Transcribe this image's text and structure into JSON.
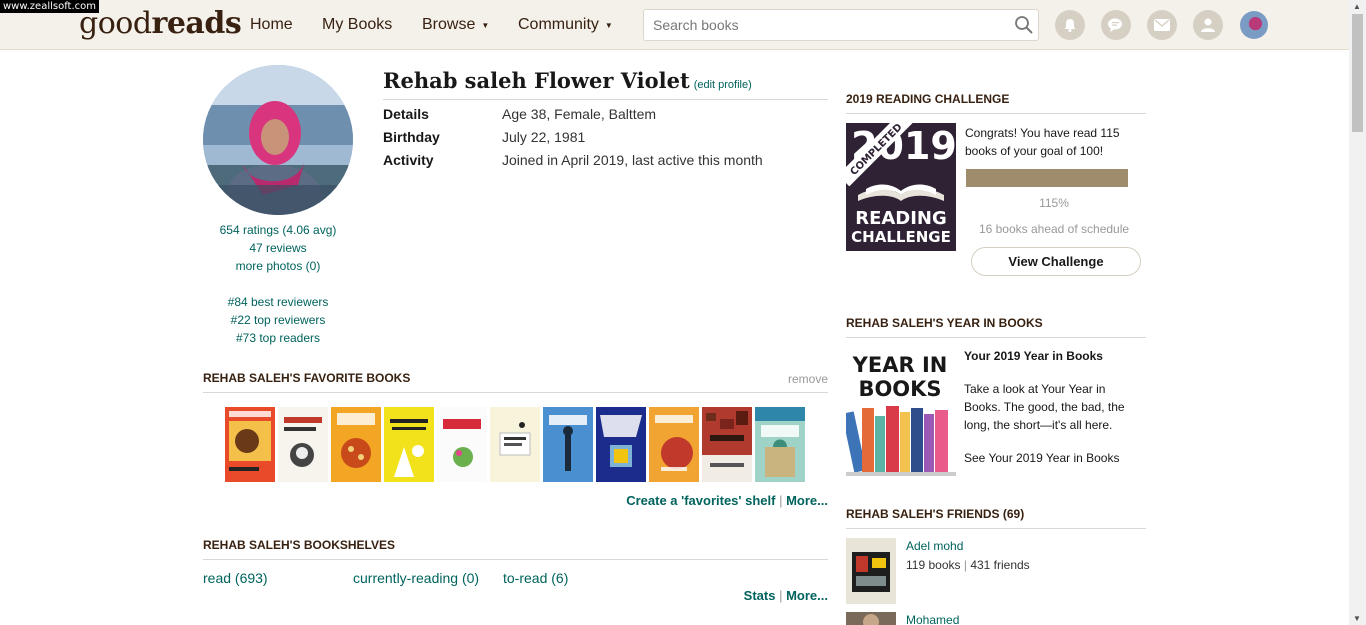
{
  "watermark": "www.zeallsoft.com",
  "header": {
    "logo_left": "good",
    "logo_right": "reads",
    "nav": {
      "home": "Home",
      "my_books": "My Books",
      "browse": "Browse",
      "community": "Community"
    },
    "search_placeholder": "Search books",
    "icons": [
      "notifications-icon",
      "discussions-icon",
      "messages-icon",
      "friends-icon",
      "user-avatar"
    ]
  },
  "profile": {
    "name": "Rehab saleh Flower Violet",
    "edit_profile": "(edit profile)",
    "details": [
      {
        "label": "Details",
        "value": "Age 38, Female, Balttem"
      },
      {
        "label": "Birthday",
        "value": "July 22, 1981"
      },
      {
        "label": "Activity",
        "value": "Joined in April 2019, last active this month"
      }
    ],
    "stats": {
      "ratings": "654 ratings (4.06 avg)",
      "reviews": "47 reviews",
      "photos": "more photos (0)"
    },
    "ranks": {
      "best_reviewers": "#84 best reviewers",
      "top_reviewers": "#22 top reviewers",
      "top_readers": "#73 top readers"
    }
  },
  "favorites": {
    "title": "REHAB SALEH'S FAVORITE BOOKS",
    "remove": "remove",
    "create_shelf": "Create a 'favorites' shelf",
    "separator": "|",
    "more": "More..."
  },
  "bookshelves": {
    "title": "REHAB SALEH'S BOOKSHELVES",
    "read": "read (693)",
    "currently_reading": "currently-reading (0)",
    "to_read": "to-read (6)",
    "stats": "Stats",
    "separator": "|",
    "more": "More..."
  },
  "challenge": {
    "title": "2019 READING CHALLENGE",
    "badge_completed": "COMPLETED",
    "badge_year": "2019",
    "badge_line1": "READING",
    "badge_line2": "CHALLENGE",
    "text": "Congrats! You have read 115 books of your goal of 100!",
    "progress_fraction": 1.0,
    "percent": "115%",
    "ahead": "16 books ahead of schedule",
    "button": "View Challenge"
  },
  "year_in_books": {
    "title": "REHAB SALEH'S YEAR IN BOOKS",
    "img_line1": "YEAR IN",
    "img_line2": "BOOKS",
    "heading": "Your 2019 Year in Books",
    "body": "Take a look at Your Year in Books. The good, the bad, the long, the short—it's all here.",
    "link": "See Your 2019 Year in Books"
  },
  "friends": {
    "title": "REHAB SALEH'S FRIENDS (69)",
    "items": [
      {
        "name": "Adel mohd",
        "books": "119 books",
        "separator": "|",
        "friends": "431 friends"
      },
      {
        "name": "Mohamed"
      }
    ]
  },
  "colors": {
    "header_bg": "#f4f1ea",
    "link": "#00635d",
    "brand": "#382110",
    "progress": "#9e8c6d"
  }
}
